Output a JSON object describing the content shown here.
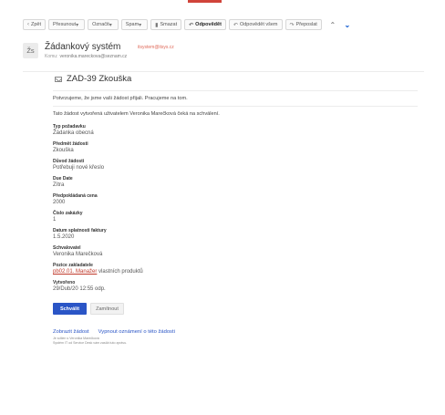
{
  "toolbar": {
    "back": "Zpět",
    "move": "Přesunout",
    "mark": "Označit",
    "spam": "Spam",
    "delete": "Smazat",
    "reply": "Odpovědět",
    "reply_all": "Odpovědět všem",
    "forward": "Přeposlat"
  },
  "message": {
    "sender_avatar": "Žs",
    "sender_name": "Žádankový systém",
    "sender_email": "itsystem@itsys.cz",
    "to_label": "Komu:",
    "recipient": "veronika.mareckova@seznam.cz",
    "subject": "ZAD-39 Zkouška"
  },
  "body": {
    "intro": "Potvrzujeme, že jsme vaši žádost přijali. Pracujeme na tom.",
    "note": "Tato žádost vytvořená uživatelem Veronika Marečková čeká na schválení.",
    "fields": [
      {
        "label": "Typ požadavku",
        "value": "Žádanka obecná"
      },
      {
        "label": "Předmět žádosti",
        "value": "Zkouška"
      },
      {
        "label": "Důvod žádosti",
        "value": "Potřebuji nové křeslo"
      },
      {
        "label": "Due Date",
        "value": "Zítra"
      },
      {
        "label": "Předpokládaná cena",
        "value": "2000"
      },
      {
        "label": "Číslo zakázky",
        "value": "1"
      },
      {
        "label": "Datum splatnosti faktury",
        "value": "1.5.2020"
      },
      {
        "label": "Schvalovatel",
        "value": "Veronika Marečková"
      }
    ],
    "position_label": "Pozice zakladatele",
    "position_link": "pb02.01. Manažer",
    "position_rest": " vlastních produktů",
    "created_label": "Vytvořeno",
    "created_value": "29/Dub/20 12:55 odp."
  },
  "actions": {
    "approve": "Schválit",
    "reject": "Zamítnout"
  },
  "footer": {
    "view_request": "Zobrazit žádost",
    "unsubscribe": "Vypnout oznámení o této žádosti",
    "note_line1": "Je sdílen s Veronika Marečková",
    "note_line2": "Systém IT od Service Desk vám zasílá tuto zprávu."
  }
}
